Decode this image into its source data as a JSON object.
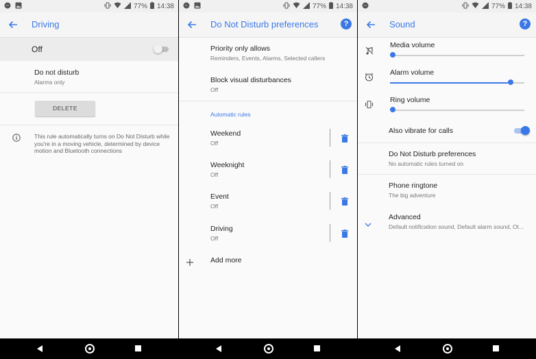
{
  "status": {
    "battery": "77%",
    "time": "14:38"
  },
  "colors": {
    "accent": "#3b78e7",
    "divider": "#e6e6e6"
  },
  "panel1": {
    "title": "Driving",
    "off_label": "Off",
    "toggle_on": false,
    "dnd": {
      "label": "Do not disturb",
      "value": "Alarms only"
    },
    "delete_label": "DELETE",
    "info_text": "This rule automatically turns on Do Not Disturb while you're in a moving vehicle, determined by device motion and Bluetooth connections"
  },
  "panel2": {
    "title": "Do Not Disturb preferences",
    "priority": {
      "label": "Priority only allows",
      "value": "Reminders, Events, Alarms, Selected callers"
    },
    "block": {
      "label": "Block visual disturbances",
      "value": "Off"
    },
    "section_label": "Automatic rules",
    "rules": [
      {
        "name": "Weekend",
        "status": "Off"
      },
      {
        "name": "Weeknight",
        "status": "Off"
      },
      {
        "name": "Event",
        "status": "Off"
      },
      {
        "name": "Driving",
        "status": "Off"
      }
    ],
    "add_more": "Add more"
  },
  "panel3": {
    "title": "Sound",
    "media": {
      "label": "Media volume",
      "level": 0.0
    },
    "alarm": {
      "label": "Alarm volume",
      "level": 0.88
    },
    "ring": {
      "label": "Ring volume",
      "level": 0.0
    },
    "vibrate": {
      "label": "Also vibrate for calls",
      "on": true
    },
    "dnd_pref": {
      "label": "Do Not Disturb preferences",
      "value": "No automatic rules turned on"
    },
    "ringtone": {
      "label": "Phone ringtone",
      "value": "The big adventure"
    },
    "advanced": {
      "label": "Advanced",
      "value": "Default notification sound, Default alarm sound, Ot..."
    }
  }
}
